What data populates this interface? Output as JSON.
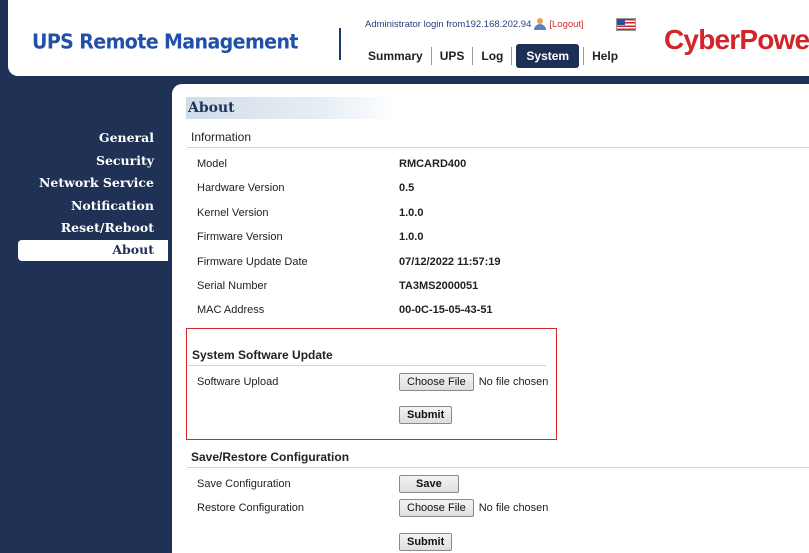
{
  "header": {
    "brand": "UPS Remote Management",
    "login_text": "Administrator login from192.168.202.94",
    "logout_label": "[Logout]",
    "logo": "CyberPower",
    "flag_icon": "us-flag-icon",
    "user_icon": "user-icon"
  },
  "nav": {
    "items": [
      "Summary",
      "UPS",
      "Log",
      "System",
      "Help"
    ],
    "active": "System"
  },
  "sidebar": {
    "items": [
      "General",
      "Security",
      "Network Service",
      "Notification",
      "Reset/Reboot",
      "About"
    ],
    "active": "About"
  },
  "page": {
    "title": "About",
    "info_head": "Information",
    "info_rows": [
      {
        "label": "Model",
        "value": "RMCARD400"
      },
      {
        "label": "Hardware Version",
        "value": "0.5"
      },
      {
        "label": "Kernel Version",
        "value": "1.0.0"
      },
      {
        "label": "Firmware Version",
        "value": "1.0.0"
      },
      {
        "label": "Firmware Update Date",
        "value": "07/12/2022 11:57:19"
      },
      {
        "label": "Serial Number",
        "value": "TA3MS2000051"
      },
      {
        "label": "MAC Address",
        "value": "00-0C-15-05-43-51"
      }
    ],
    "update_head": "System Software Update",
    "upload_label": "Software Upload",
    "choose_file": "Choose File",
    "no_file": "No file chosen",
    "submit": "Submit",
    "config_head": "Save/Restore Configuration",
    "save_config_label": "Save Configuration",
    "save": "Save",
    "restore_config_label": "Restore Configuration",
    "choose_file_2": "Choose File",
    "no_file_2": "No file chosen",
    "submit_2": "Submit"
  },
  "colors": {
    "navy": "#1f3256",
    "brand_blue": "#2050a8",
    "logo_red": "#d2242a",
    "highlight_red": "#d9262c"
  }
}
